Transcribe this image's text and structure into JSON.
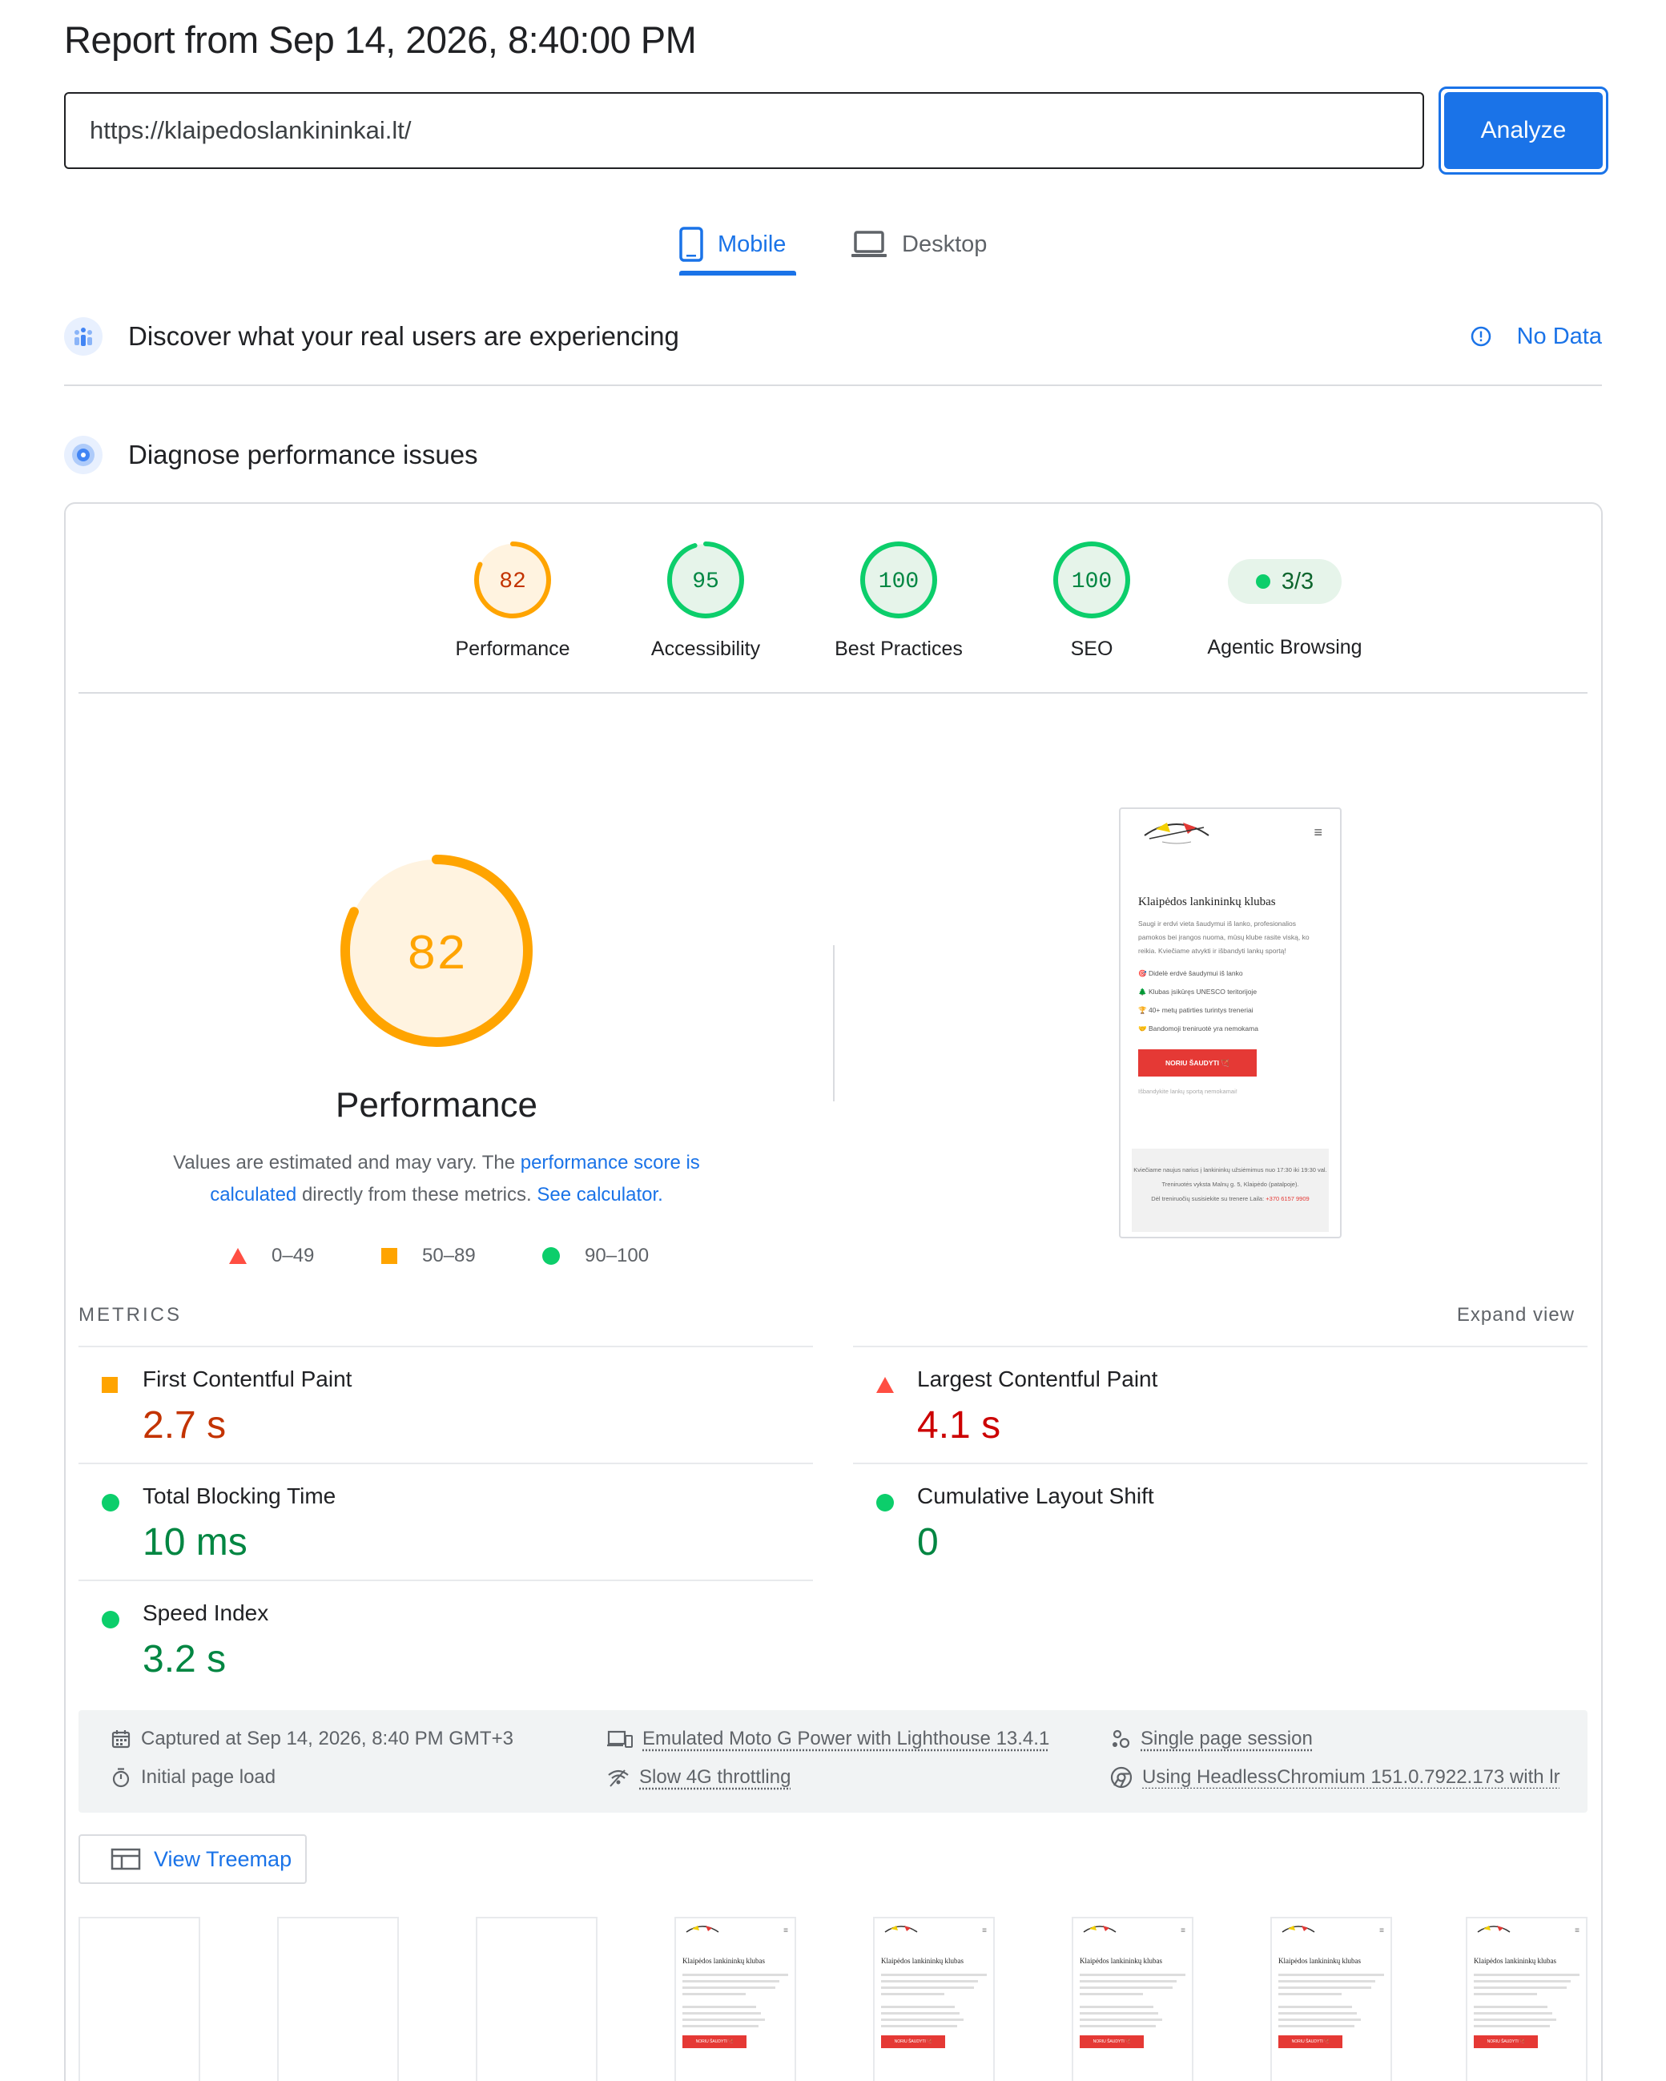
{
  "header": {
    "title": "Report from Sep 14, 2026, 8:40:00 PM",
    "url_value": "https://klaipedoslankininkai.lt/",
    "analyze_label": "Analyze"
  },
  "tabs": [
    {
      "label": "Mobile",
      "active": true
    },
    {
      "label": "Desktop",
      "active": false
    }
  ],
  "field_data": {
    "title": "Discover what your real users are experiencing",
    "status": "No Data"
  },
  "lab": {
    "title": "Diagnose performance issues"
  },
  "scores": [
    {
      "label": "Performance",
      "value": "82",
      "fraction": 0.82
    },
    {
      "label": "Accessibility",
      "value": "95",
      "fraction": 0.95
    },
    {
      "label": "Best Practices",
      "value": "100",
      "fraction": 1.0
    },
    {
      "label": "SEO",
      "value": "100",
      "fraction": 1.0
    }
  ],
  "agentic": {
    "label": "Agentic Browsing",
    "value": "3/3"
  },
  "performance": {
    "score": "82",
    "fraction": 0.82,
    "title": "Performance",
    "desc_1": "Values are estimated and may vary. The ",
    "desc_link_1": "performance score is calculated",
    "desc_2": " directly from these metrics. ",
    "desc_link_2": "See calculator.",
    "legend": [
      "0–49",
      "50–89",
      "90–100"
    ]
  },
  "site_preview": {
    "menu_glyph": "≡",
    "heading": "Klaipėdos lankininkų klubas",
    "intro": "Saugi ir erdvi vieta šaudymui iš lanko, profesionalios pamokos bei įrangos nuoma, mūsų klube rasite viską, ko reikia. Kviečiame atvykti ir išbandyti lankų sportą!",
    "bullets": [
      "🎯 Didelė erdvė šaudymui iš lanko",
      "🌲 Klubas įsikūręs UNESCO teritorijoje",
      "🏆 40+ metų patirties turintys treneriai",
      "🤝 Bandomoji treniruotė yra nemokama"
    ],
    "cta": "NORIU ŠAUDYTI 🏹",
    "note": "Išbandykite lankų sportą nemokamai!",
    "footer_1": "Kviečiame naujus narius į lankininkų užsiėmimus nuo 17:30 iki 19:30 val.",
    "footer_2": "Treniruotės vyksta Malnų g. 5, Klaipėdo (patalpoje).",
    "footer_3": "Dėl treniruočių susisiekite su trenere Laila: ",
    "footer_phone": "+370 6157 9909"
  },
  "metrics": {
    "heading": "METRICS",
    "expand_label": "Expand view",
    "items": [
      {
        "label": "First Contentful Paint",
        "value": "2.7 s",
        "rating": "average"
      },
      {
        "label": "Largest Contentful Paint",
        "value": "4.1 s",
        "rating": "fail"
      },
      {
        "label": "Total Blocking Time",
        "value": "10 ms",
        "rating": "pass"
      },
      {
        "label": "Cumulative Layout Shift",
        "value": "0",
        "rating": "pass"
      },
      {
        "label": "Speed Index",
        "value": "3.2 s",
        "rating": "pass"
      }
    ]
  },
  "environment": {
    "captured": "Captured at Sep 14, 2026, 8:40 PM GMT+3",
    "load": "Initial page load",
    "device": "Emulated Moto G Power with Lighthouse 13.4.1",
    "throttling": "Slow 4G throttling",
    "session": "Single page session",
    "browser": "Using HeadlessChromium 151.0.7922.173 with lr"
  },
  "treemap_label": "View Treemap",
  "colors": {
    "accent": "#1a73e8",
    "pass": "#0cce6b",
    "average": "#ffa400",
    "fail": "#ff4e42"
  }
}
